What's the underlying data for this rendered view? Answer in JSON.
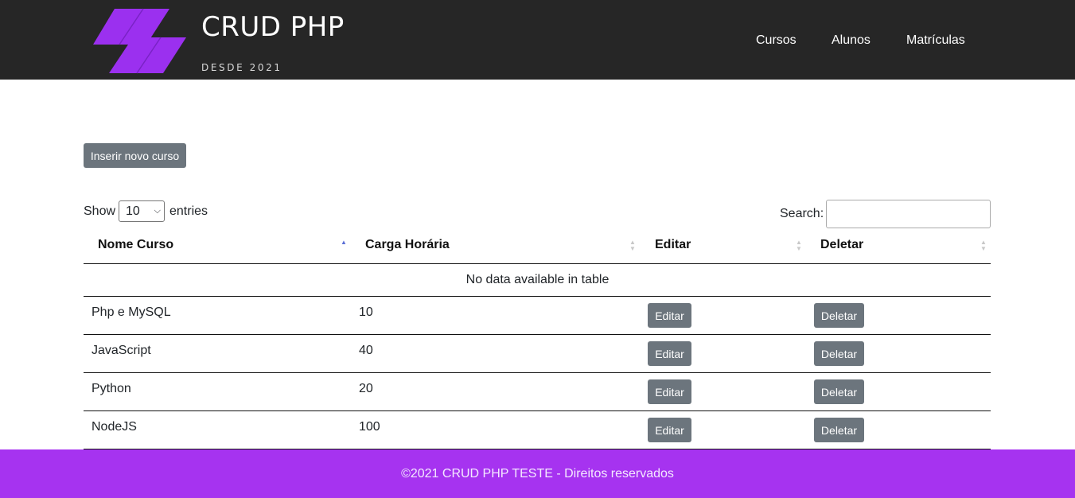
{
  "brand": {
    "title": "CRUD PHP",
    "subtitle": "DESDE 2021",
    "accent": "#9b30ef"
  },
  "nav": {
    "items": [
      "Cursos",
      "Alunos",
      "Matrículas"
    ]
  },
  "actions": {
    "insert_label": "Inserir novo curso"
  },
  "table_controls": {
    "show_label": "Show",
    "page_size": "10",
    "entries_label": "entries",
    "search_label": "Search:",
    "search_value": ""
  },
  "table": {
    "headers": [
      "Nome Curso",
      "Carga Horária",
      "Editar",
      "Deletar"
    ],
    "empty_message": "No data available in table",
    "rows": [
      {
        "name": "Php e MySQL",
        "hours": "10",
        "edit": "Editar",
        "delete": "Deletar"
      },
      {
        "name": "JavaScript",
        "hours": "40",
        "edit": "Editar",
        "delete": "Deletar"
      },
      {
        "name": "Python",
        "hours": "20",
        "edit": "Editar",
        "delete": "Deletar"
      },
      {
        "name": "NodeJS",
        "hours": "100",
        "edit": "Editar",
        "delete": "Deletar"
      }
    ]
  },
  "footer": {
    "text": "©2021 CRUD PHP TESTE - Direitos reservados",
    "background": "#a633f0"
  }
}
